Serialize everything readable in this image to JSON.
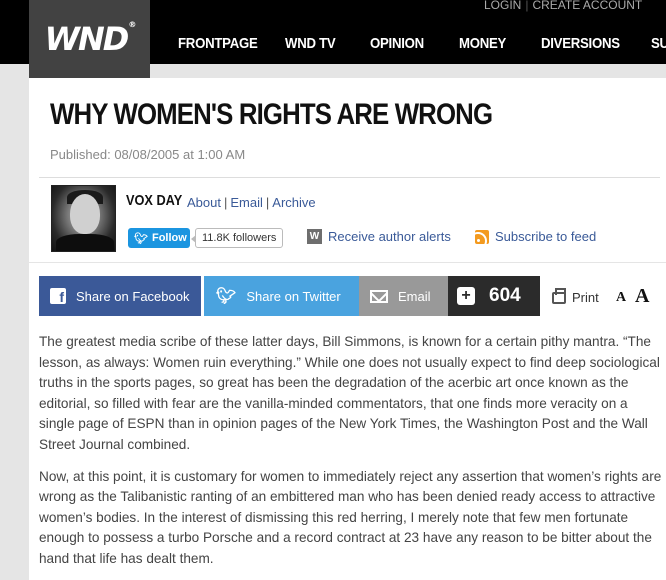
{
  "site": {
    "logo": "WND",
    "logo_tm": "®"
  },
  "utility": {
    "login": "LOGIN",
    "create_account": "CREATE ACCOUNT"
  },
  "nav": {
    "items": [
      "FRONTPAGE",
      "WND TV",
      "OPINION",
      "MONEY",
      "DIVERSIONS",
      "SU"
    ]
  },
  "article": {
    "title": "WHY WOMEN'S RIGHTS ARE WRONG",
    "published": "Published: 08/08/2005 at 1:00 AM",
    "paragraphs": [
      "The greatest media scribe of these latter days, Bill Simmons, is known for a certain pithy mantra. “The lesson, as always: Women ruin everything.” While one does not usually expect to find deep sociological truths in the sports pages, so great has been the degradation of the acerbic art once known as the editorial, so filled with fear are the vanilla-minded commentators, that one finds more veracity on a single page of ESPN than in opinion pages of the New York Times, the Washington Post and the Wall Street Journal combined.",
      "Now, at this point, it is customary for women to immediately reject any assertion that women’s rights are wrong as the Talibanistic ranting of an embittered man who has been denied ready access to attractive women’s bodies. In the interest of dismissing this red herring, I merely note that few men fortunate enough to possess a turbo Porsche and a record contract at 23 have any reason to be bitter about the hand that life has dealt them."
    ]
  },
  "author": {
    "name": "VOX DAY",
    "about": "About",
    "email": "Email",
    "archive": "Archive",
    "follow": "Follow",
    "followers": "11.8K followers",
    "alerts": "Receive author alerts",
    "alerts_icon_letter": "W",
    "subscribe": "Subscribe to feed"
  },
  "share": {
    "facebook": "Share on Facebook",
    "twitter": "Share on Twitter",
    "email": "Email",
    "count": "604",
    "print": "Print",
    "font_small": "A",
    "font_large": "A"
  },
  "colors": {
    "facebook": "#3b5998",
    "twitter": "#4aa3df",
    "email": "#999999",
    "count_bg": "#2b2b2b",
    "link": "#3a5a98",
    "follow": "#1b95e0",
    "rss": "#f39a1f"
  }
}
